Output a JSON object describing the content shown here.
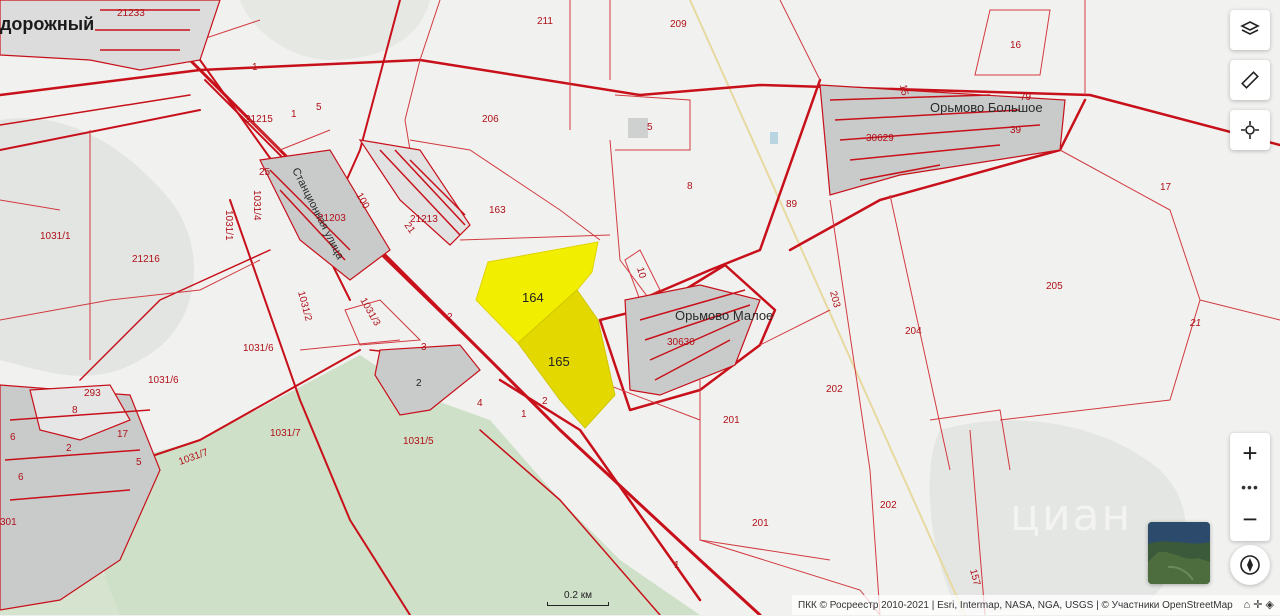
{
  "map": {
    "place_labels": {
      "town": "дорожный",
      "village_big": "Орьмово Большое",
      "village_small": "Орьмово Малое",
      "street": "Станционная улица"
    },
    "parcel_labels": {
      "p164": "164",
      "p165": "165",
      "p163": "163",
      "p206": "206",
      "p211": "211",
      "p209": "209",
      "p16": "16",
      "p8": "8",
      "p5a": "5",
      "p89": "89",
      "p17": "17",
      "p205": "205",
      "p204": "204",
      "p203": "203",
      "p202a": "202",
      "p202b": "202",
      "p201a": "201",
      "p201b": "201",
      "p21a": "21",
      "p10": "10",
      "p30630": "30630",
      "p30629": "30629",
      "p15": "15",
      "p79": "79",
      "p39": "39",
      "p21233": "21233",
      "p21215": "21215",
      "p1a": "1",
      "p5b": "5",
      "p1b": "1",
      "p25": "25",
      "p21203": "21203",
      "p100": "100",
      "p21213": "21213",
      "p21b": "21",
      "p1031_1": "1031/1",
      "p21216": "21216",
      "p1031_1b": "1031/1",
      "p1031_4": "1031/4",
      "p1031_2": "1031/2",
      "p1031_3": "1031/3",
      "p1031_6": "1031/6",
      "p1031_6b": "1031/6",
      "p1031_7": "1031/7",
      "p1031_7b": "1031/7",
      "p1031_5": "1031/5",
      "p2a": "2",
      "p3": "3",
      "p2b": "2",
      "p4": "4",
      "p1c": "1",
      "p2c": "2",
      "p293": "293",
      "p8b": "8",
      "p17b": "17",
      "p6": "6",
      "p2d": "2",
      "p5c": "5",
      "p6b": "6",
      "p301": "301",
      "p1d": "1",
      "p157": "157"
    },
    "highlight_fill": "#f2ee00",
    "highlight_fill_2": "#e3d800",
    "boundary_color": "#c8101a"
  },
  "controls": {
    "layers_icon": "layers-icon",
    "ruler_icon": "ruler-icon",
    "locate_icon": "crosshair-icon",
    "zoom_in": "+",
    "zoom_more": "•••",
    "zoom_out": "−",
    "compass_icon": "compass-icon"
  },
  "scale_label": "0.2 км",
  "attribution": "ПКК © Росреестр 2010-2021 | Esri, Intermap, NASA, NGA, USGS | © Участники OpenStreetMap",
  "watermark": "циан"
}
